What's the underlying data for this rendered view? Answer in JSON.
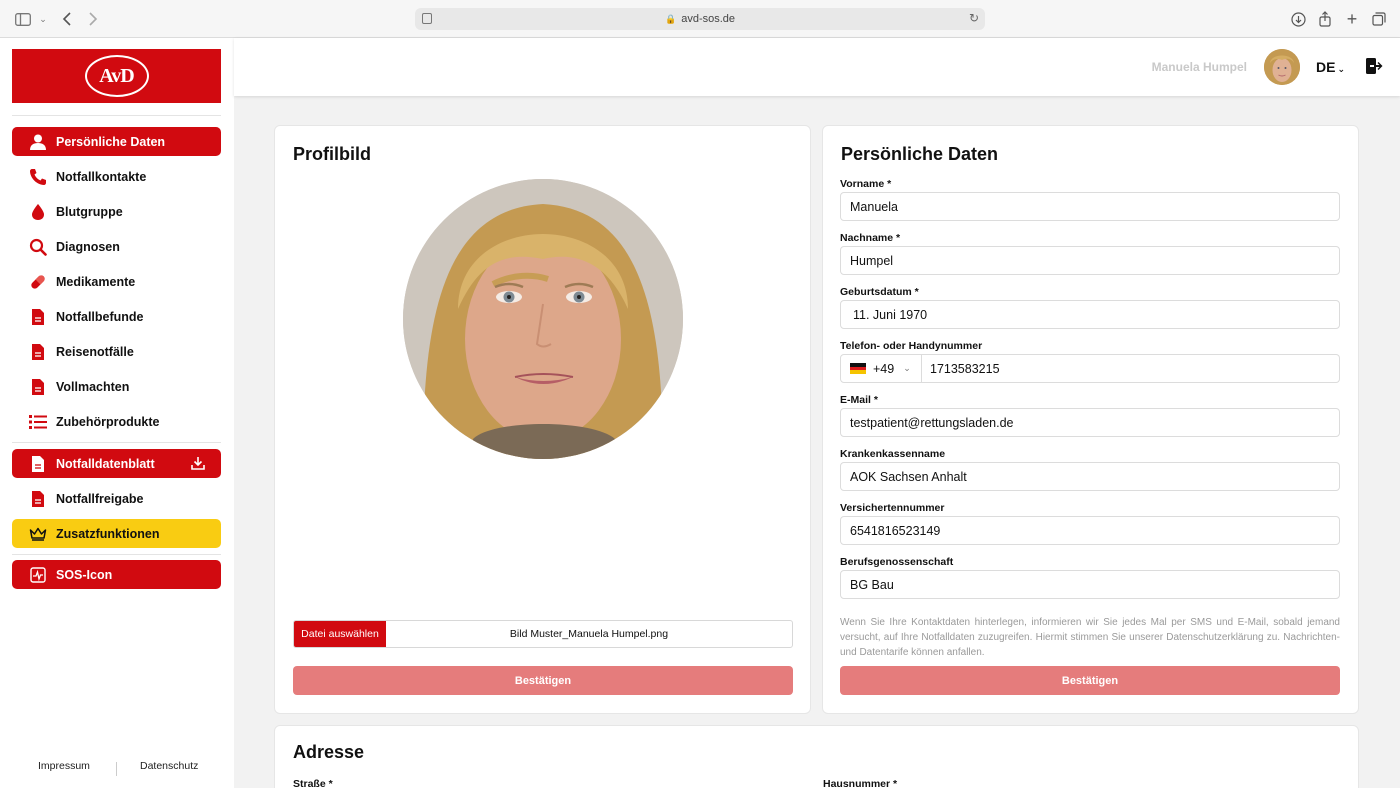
{
  "browser": {
    "url": "avd-sos.de"
  },
  "sidebar": {
    "logo_text": "AvD",
    "items": [
      {
        "label": "Persönliche Daten",
        "icon": "person-icon"
      },
      {
        "label": "Notfallkontakte",
        "icon": "phone-icon"
      },
      {
        "label": "Blutgruppe",
        "icon": "blood-drop-icon"
      },
      {
        "label": "Diagnosen",
        "icon": "search-icon"
      },
      {
        "label": "Medikamente",
        "icon": "pill-icon"
      },
      {
        "label": "Notfallbefunde",
        "icon": "document-icon"
      },
      {
        "label": "Reisenotfälle",
        "icon": "document-icon"
      },
      {
        "label": "Vollmachten",
        "icon": "document-icon"
      },
      {
        "label": "Zubehörprodukte",
        "icon": "list-icon"
      }
    ],
    "datenblatt": {
      "label": "Notfalldatenblatt",
      "icon": "document-icon"
    },
    "freigabe": {
      "label": "Notfallfreigabe",
      "icon": "document-icon"
    },
    "zusatz": {
      "label": "Zusatzfunktionen",
      "icon": "crown-icon"
    },
    "sos": {
      "label": "SOS-Icon",
      "icon": "pulse-icon"
    },
    "footer": {
      "impressum": "Impressum",
      "datenschutz": "Datenschutz"
    },
    "colors": {
      "brand_red": "#d10a10",
      "gold": "#f9cc12"
    }
  },
  "topbar": {
    "user_name": "Manuela Humpel",
    "language": "DE"
  },
  "profile_card": {
    "title": "Profilbild",
    "file_button": "Datei auswählen",
    "file_name": "Bild Muster_Manuela Humpel.png",
    "confirm": "Bestätigen"
  },
  "personal_card": {
    "title": "Persönliche Daten",
    "fields": {
      "vorname": {
        "label": "Vorname *",
        "value": "Manuela"
      },
      "nachname": {
        "label": "Nachname *",
        "value": "Humpel"
      },
      "geburtsdatum": {
        "label": "Geburtsdatum *",
        "value": "11. Juni 1970"
      },
      "telefon": {
        "label": "Telefon- oder Handynummer",
        "code": "+49",
        "value": "1713583215"
      },
      "email": {
        "label": "E-Mail *",
        "value": "testpatient@rettungsladen.de"
      },
      "krankenkasse": {
        "label": "Krankenkassenname",
        "value": "AOK Sachsen Anhalt"
      },
      "versichertennummer": {
        "label": "Versichertennummer",
        "value": "6541816523149"
      },
      "berufsgenossenschaft": {
        "label": "Berufsgenossenschaft",
        "value": "BG Bau"
      }
    },
    "note": "Wenn Sie Ihre Kontaktdaten hinterlegen, informieren wir Sie jedes Mal per SMS und E-Mail, sobald jemand versucht, auf Ihre Notfalldaten zuzugreifen. Hiermit stimmen Sie unserer Datenschutzerklärung zu. Nachrichten- und Datentarife können anfallen.",
    "confirm": "Bestätigen"
  },
  "address_card": {
    "title": "Adresse",
    "street_label": "Straße *",
    "house_label": "Hausnummer *"
  }
}
